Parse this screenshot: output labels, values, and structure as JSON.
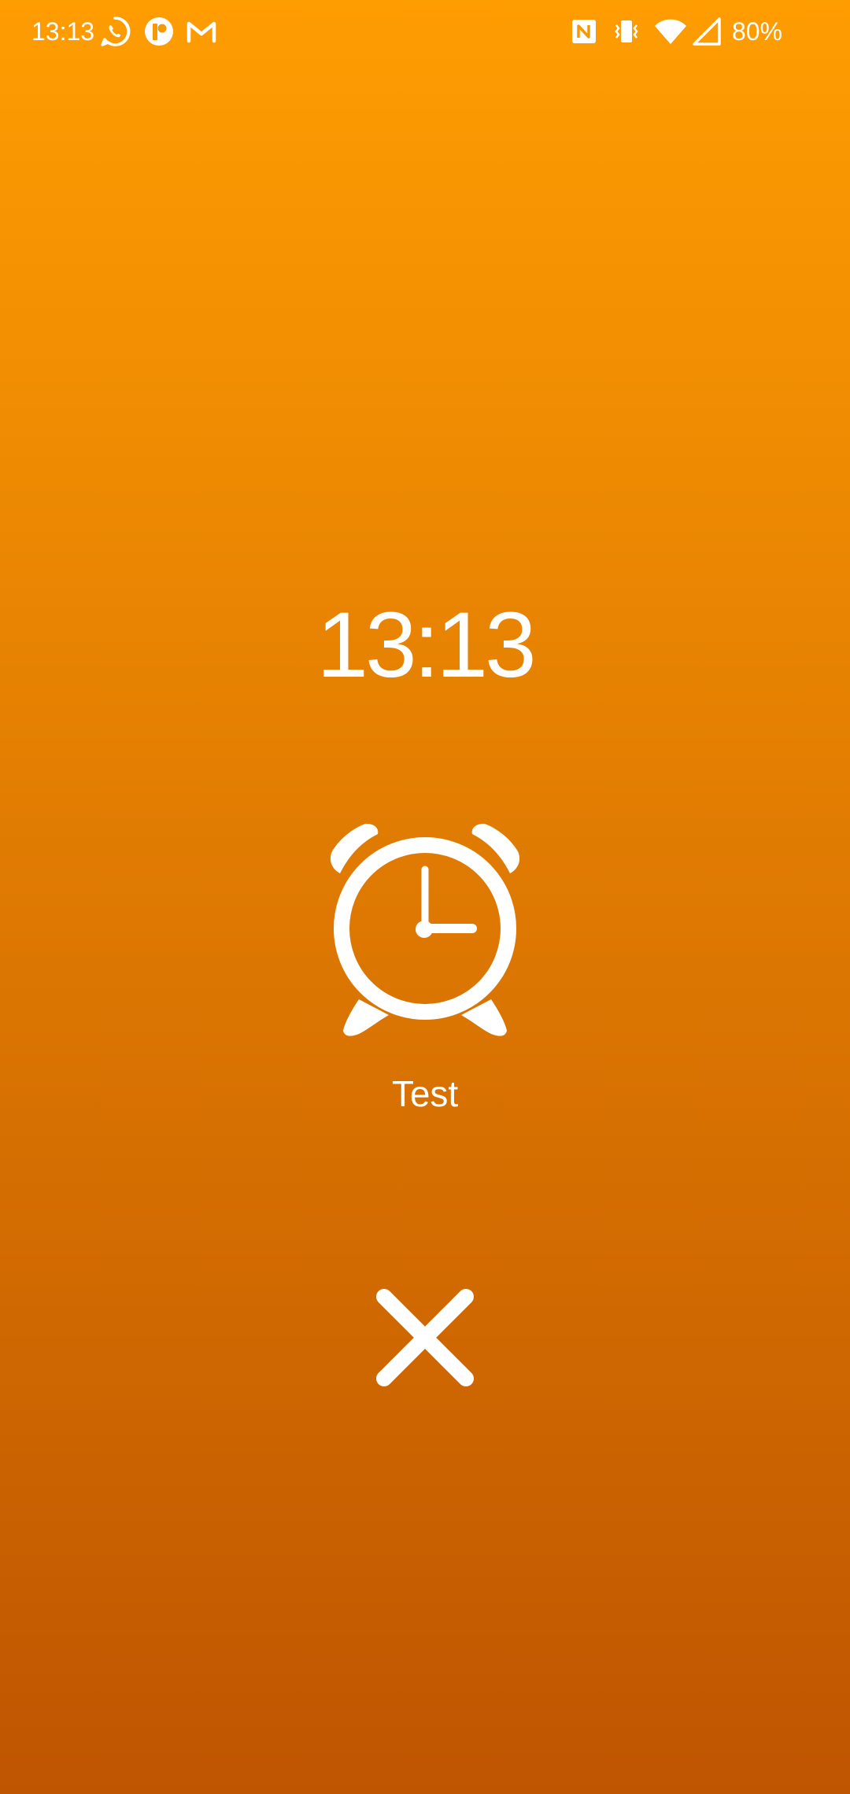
{
  "status_bar": {
    "time": "13:13",
    "battery": "80%",
    "left_icons": [
      "whatsapp-icon",
      "messenger-app-icon",
      "gmail-icon"
    ],
    "right_icons": [
      "nfc-icon",
      "vibrate-icon",
      "wifi-icon",
      "cell-signal-icon"
    ]
  },
  "alarm": {
    "time": "13:13",
    "label": "Test",
    "icon": "alarm-clock-icon",
    "dismiss_icon": "close-icon"
  },
  "colors": {
    "gradient_top": "#FE9D02",
    "gradient_bottom": "#BF5501",
    "foreground": "#FFFFFF"
  }
}
